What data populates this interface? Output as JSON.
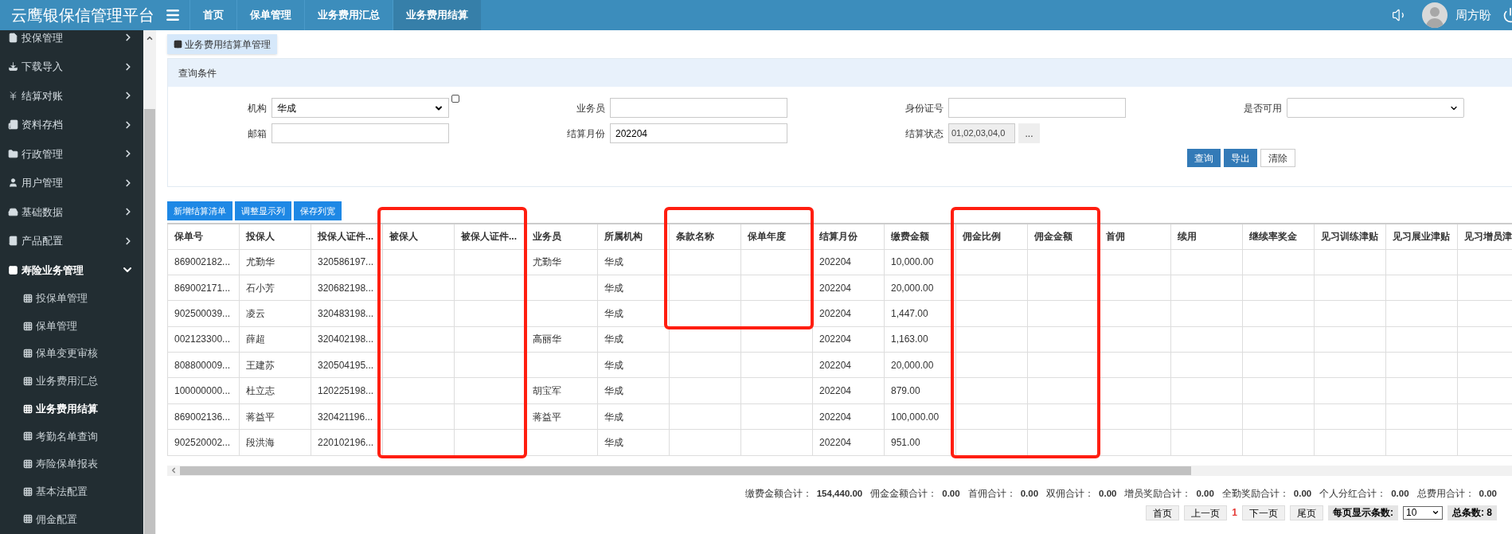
{
  "app_title": "云鹰银保信管理平台",
  "nav_tabs": [
    {
      "label": "首页",
      "selected": false
    },
    {
      "label": "保单管理",
      "selected": false
    },
    {
      "label": "业务费用汇总",
      "selected": false
    },
    {
      "label": "业务费用结算",
      "selected": true
    }
  ],
  "user": {
    "name": "周方盼"
  },
  "sidebar": {
    "items": [
      {
        "label": "投保管理",
        "expanded": false
      },
      {
        "label": "下载导入",
        "expanded": false
      },
      {
        "label": "结算对账",
        "expanded": false
      },
      {
        "label": "资料存档",
        "expanded": false
      },
      {
        "label": "行政管理",
        "expanded": false
      },
      {
        "label": "用户管理",
        "expanded": false
      },
      {
        "label": "基础数据",
        "expanded": false
      },
      {
        "label": "产品配置",
        "expanded": false
      },
      {
        "label": "寿险业务管理",
        "expanded": true,
        "children": [
          {
            "label": "投保单管理",
            "selected": false
          },
          {
            "label": "保单管理",
            "selected": false
          },
          {
            "label": "保单变更审核",
            "selected": false
          },
          {
            "label": "业务费用汇总",
            "selected": false
          },
          {
            "label": "业务费用结算",
            "selected": true
          },
          {
            "label": "考勤名单查询",
            "selected": false
          },
          {
            "label": "寿险保单报表",
            "selected": false
          },
          {
            "label": "基本法配置",
            "selected": false
          },
          {
            "label": "佣金配置",
            "selected": false
          }
        ]
      }
    ]
  },
  "page_tab": "业务费用结算单管理",
  "query": {
    "title": "查询条件",
    "fields": [
      {
        "label": "机构",
        "kind": "select",
        "value": "华成",
        "checkbox": {
          "checked": false
        }
      },
      {
        "label": "业务员",
        "kind": "input"
      },
      {
        "label": "身份证号",
        "kind": "input"
      },
      {
        "label": "是否可用",
        "kind": "select"
      },
      {
        "label": "邮箱",
        "kind": "input"
      },
      {
        "label": "结算月份",
        "kind": "input",
        "value": "202204"
      },
      {
        "label": "结算状态",
        "kind": "picker",
        "value": "01,02,03,04,0",
        "button": "..."
      }
    ],
    "buttons": [
      {
        "label": "查询",
        "kind": "primary"
      },
      {
        "label": "导出",
        "kind": "primary"
      },
      {
        "label": "清除",
        "kind": "plain"
      }
    ]
  },
  "toolbar": [
    "新增结算清单",
    "调整显示列",
    "保存列宽"
  ],
  "table": {
    "columns": [
      {
        "label": "保单号",
        "framed": false
      },
      {
        "label": "投保人",
        "framed": false
      },
      {
        "label": "投保人证件...",
        "framed": false
      },
      {
        "label": "被保人",
        "framed": true,
        "frame_full_height": true
      },
      {
        "label": "被保人证件...",
        "framed": true,
        "frame_full_height": true
      },
      {
        "label": "业务员",
        "framed": false
      },
      {
        "label": "所属机构",
        "framed": false
      },
      {
        "label": "条款名称",
        "framed": true,
        "frame_full_height": false
      },
      {
        "label": "保单年度",
        "framed": true,
        "frame_full_height": false
      },
      {
        "label": "结算月份",
        "framed": false
      },
      {
        "label": "缴费金额",
        "framed": false
      },
      {
        "label": "佣金比例",
        "framed": true,
        "frame_full_height": true
      },
      {
        "label": "佣金金额",
        "framed": true,
        "frame_full_height": true
      },
      {
        "label": "首佣",
        "framed": false
      },
      {
        "label": "续用",
        "framed": false
      },
      {
        "label": "继续率奖金",
        "framed": false
      },
      {
        "label": "见习训练津贴",
        "framed": false
      },
      {
        "label": "见习展业津贴",
        "framed": false
      },
      {
        "label": "见习增员津",
        "framed": false
      }
    ],
    "rows": [
      {
        "policy_no": "869002182...",
        "applicant": "尤勤华",
        "applicant_id": "320586197...",
        "agent": "尤勤华",
        "org": "华成",
        "month": "202204",
        "premium": "10,000.00"
      },
      {
        "policy_no": "869002171...",
        "applicant": "石小芳",
        "applicant_id": "320682198...",
        "org": "华成",
        "month": "202204",
        "premium": "20,000.00"
      },
      {
        "policy_no": "902500039...",
        "applicant": "凌云",
        "applicant_id": "320483198...",
        "org": "华成",
        "month": "202204",
        "premium": "1,447.00"
      },
      {
        "policy_no": "002123300...",
        "applicant": "薛超",
        "applicant_id": "320402198...",
        "agent": "高丽华",
        "org": "华成",
        "month": "202204",
        "premium": "1,163.00"
      },
      {
        "policy_no": "808800009...",
        "applicant": "王建苏",
        "applicant_id": "320504195...",
        "org": "华成",
        "month": "202204",
        "premium": "20,000.00"
      },
      {
        "policy_no": "100000000...",
        "applicant": "杜立志",
        "applicant_id": "120225198...",
        "agent": "胡宝军",
        "org": "华成",
        "month": "202204",
        "premium": "879.00"
      },
      {
        "policy_no": "869002136...",
        "applicant": "蒋益平",
        "applicant_id": "320421196...",
        "agent": "蒋益平",
        "org": "华成",
        "month": "202204",
        "premium": "100,000.00"
      },
      {
        "policy_no": "902520002...",
        "applicant": "段洪海",
        "applicant_id": "220102196...",
        "org": "华成",
        "month": "202204",
        "premium": "951.00"
      }
    ]
  },
  "totals": [
    {
      "label": "缴费金额合计：",
      "value": "154,440.00"
    },
    {
      "label": "佣金金额合计：",
      "value": "0.00"
    },
    {
      "label": "首佣合计：",
      "value": "0.00"
    },
    {
      "label": "双佣合计：",
      "value": "0.00"
    },
    {
      "label": "增员奖励合计：",
      "value": "0.00"
    },
    {
      "label": "全勤奖励合计：",
      "value": "0.00"
    },
    {
      "label": "个人分红合计：",
      "value": "0.00"
    },
    {
      "label": "总费用合计：",
      "value": "0.00"
    }
  ],
  "pagination": {
    "first": "首页",
    "prev": "上一页",
    "current": "1",
    "next": "下一页",
    "last": "尾页",
    "page_size_label": "每页显示条数:",
    "page_size": "10",
    "total": "总条数: 8"
  }
}
